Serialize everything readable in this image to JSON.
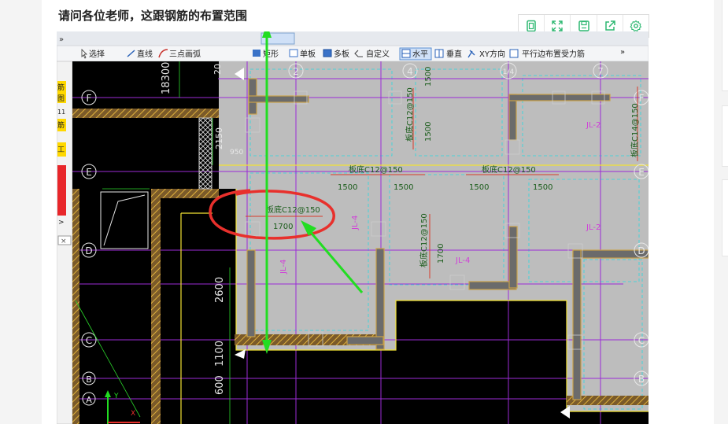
{
  "question": {
    "title": "请问各位老师，这跟钢筋的布置范围"
  },
  "viewer_toolbar": {
    "icons": [
      "fit-page-icon",
      "fullscreen-icon",
      "save-icon",
      "share-icon",
      "settings-icon"
    ]
  },
  "cad_screenshot": {
    "toolbar_items": {
      "select": "选择",
      "line": "直线",
      "arc": "三点画弧",
      "rect": "矩形",
      "single_slab": "单板",
      "multi_slab": "多板",
      "custom": "自定义",
      "horizontal": "水平",
      "vertical": "垂直",
      "xy_direction": "XY方向",
      "parallel_edge": "平行边布置受力筋",
      "more": "»"
    },
    "axis_labels": {
      "row_f": "F",
      "row_e": "E",
      "row_d": "D",
      "row_c": "C",
      "row_b": "B",
      "row_a": "A",
      "col_2": "2",
      "col_4": "4",
      "col_7": "7",
      "col_4a": "1/4"
    },
    "rebar_labels": {
      "bottom_c12_150": "板底C12@150",
      "side_c14_150": "板底C14@150",
      "spans": [
        "1500",
        "1500",
        "1500",
        "1500",
        "1700",
        "1500",
        "1500",
        "1700"
      ]
    },
    "beam_labels": {
      "jl2": "JL-2",
      "jl4": "JL-4"
    },
    "dimensions": {
      "d18300": "18300",
      "d2150": "2150",
      "d950": "950",
      "d2600": "2600",
      "d1100": "1100",
      "d600": "600",
      "d20": "20"
    },
    "left_panel_chars": [
      "筋",
      "图",
      "11",
      "筋",
      "工",
      ">",
      "×"
    ],
    "ucs": {
      "y": "Y",
      "x": "X"
    },
    "colors": {
      "cad_bg": "#000000",
      "slab_fill": "#bdbdbd",
      "grid_line": "#9b2bd6",
      "dimension_green": "#2bd62b",
      "annotation_red": "#e8302c",
      "annotation_green": "#22dd22"
    }
  }
}
